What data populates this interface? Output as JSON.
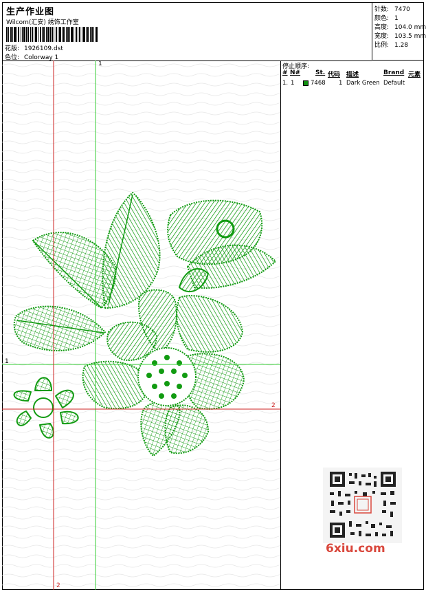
{
  "header": {
    "title": "生产作业图",
    "studio": "Wilcom(汇安) 绣饰工作室",
    "design_label": "花版:",
    "design_value": "1926109.dst",
    "colorway_label": "色位:",
    "colorway_value": "Colorway 1"
  },
  "stats": {
    "stitches_label": "针数:",
    "stitches_value": "7470",
    "colors_label": "颜色:",
    "colors_value": "1",
    "height_label": "高度:",
    "height_value": "104.0 mm",
    "width_label": "宽度:",
    "width_value": "103.5 mm",
    "scale_label": "比例:",
    "scale_value": "1.28"
  },
  "stop_sequence": {
    "title": "停止顺序:",
    "columns": [
      "#",
      "N#",
      "St.",
      "代码",
      "描述",
      "Brand",
      "元素"
    ],
    "rows": [
      {
        "index": "1.",
        "needle": "1",
        "code": "7468",
        "stitches": "1",
        "description": "Dark Green",
        "brand": "Default",
        "color": "#109010"
      }
    ]
  },
  "guides": {
    "v1_label": "1",
    "h1_label": "1",
    "h2_label": "2",
    "v2_label": "2"
  },
  "watermark": {
    "text": "6xiu.com"
  },
  "colors": {
    "thread": "#119b11",
    "guide_green": "#33cc33",
    "guide_red": "#cc2222"
  }
}
